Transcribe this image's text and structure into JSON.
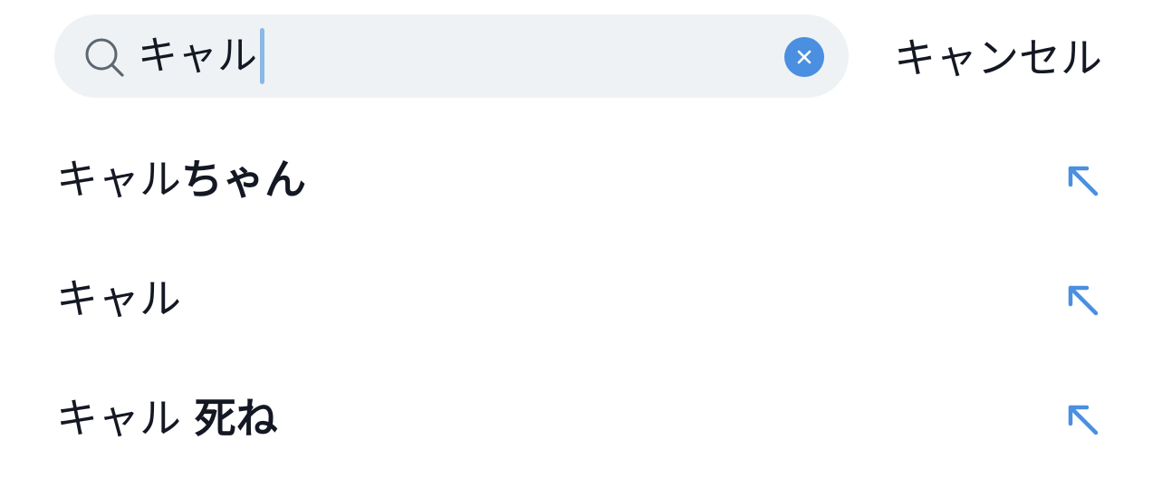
{
  "search": {
    "query": "キャル",
    "clear_icon": "clear-circle-icon",
    "search_icon": "search-icon"
  },
  "cancel_label": "キャンセル",
  "suggestions": [
    {
      "typed": "キャル",
      "completion": "ちゃん",
      "action_icon": "fill-query-arrow-icon"
    },
    {
      "typed": "キャル",
      "completion": "",
      "action_icon": "fill-query-arrow-icon"
    },
    {
      "typed": "キャル ",
      "completion": "死ね",
      "action_icon": "fill-query-arrow-icon"
    }
  ],
  "colors": {
    "accent": "#4a8fe0",
    "search_bg": "#eff2f4",
    "caret": "#8ab8e6",
    "text": "#141823"
  }
}
